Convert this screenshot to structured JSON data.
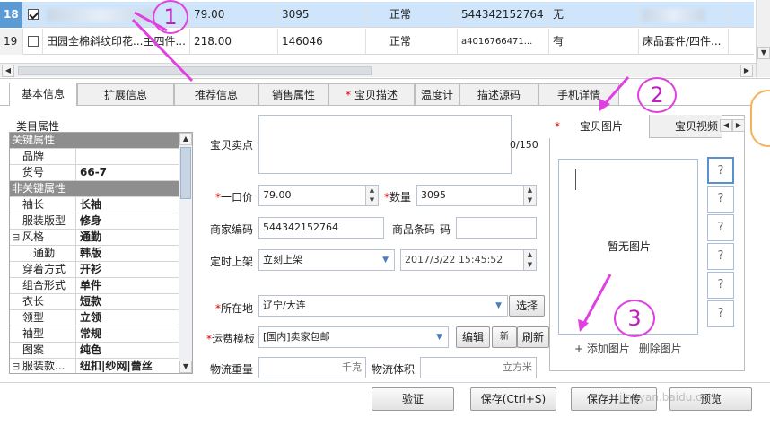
{
  "grid": {
    "rows": [
      {
        "num": "18",
        "checked": true,
        "title": "",
        "price": "79.00",
        "stock": "3095",
        "status": "正常",
        "code": "544342152764",
        "flag": "无",
        "category": ""
      },
      {
        "num": "19",
        "checked": false,
        "title": "田园全棉斜纹印花...主四件...",
        "price": "218.00",
        "stock": "146046",
        "status": "正常",
        "code": "a4016766471...",
        "flag": "有",
        "category": "床品套件/四件..."
      }
    ]
  },
  "tabs": [
    {
      "label": "基本信息",
      "required": false
    },
    {
      "label": "扩展信息",
      "required": false
    },
    {
      "label": "推荐信息",
      "required": false
    },
    {
      "label": "销售属性",
      "required": false
    },
    {
      "label": "宝贝描述",
      "required": true
    },
    {
      "label": "温度计",
      "required": false
    },
    {
      "label": "描述源码",
      "required": false
    },
    {
      "label": "手机详情",
      "required": false
    }
  ],
  "props": {
    "title": "类目属性",
    "rows": [
      {
        "k": "关键属性",
        "v": "",
        "header": true
      },
      {
        "k": "品牌",
        "v": ""
      },
      {
        "k": "货号",
        "v": "66-7"
      },
      {
        "k": "非关键属性",
        "v": "",
        "header": true
      },
      {
        "k": "袖长",
        "v": "长袖"
      },
      {
        "k": "服装版型",
        "v": "修身"
      },
      {
        "k": "风格",
        "v": "通勤",
        "expander": "−"
      },
      {
        "k": "通勤",
        "v": "韩版",
        "indent": true
      },
      {
        "k": "穿着方式",
        "v": "开衫"
      },
      {
        "k": "组合形式",
        "v": "单件"
      },
      {
        "k": "衣长",
        "v": "短款"
      },
      {
        "k": "领型",
        "v": "立领"
      },
      {
        "k": "袖型",
        "v": "常规"
      },
      {
        "k": "图案",
        "v": "纯色"
      },
      {
        "k": "服装款...",
        "v": "纽扣|纱网|蕾丝",
        "expander": "−"
      }
    ]
  },
  "form": {
    "selling_point_label": "宝贝卖点",
    "selling_point_count": "0/150",
    "price_label": "一口价",
    "price_value": "79.00",
    "qty_label": "数量",
    "qty_value": "3095",
    "merchant_code_label": "商家编码",
    "merchant_code_value": "544342152764",
    "barcode_label": "商品条码",
    "barcode_suffix": "码",
    "schedule_label": "定时上架",
    "schedule_value": "立刻上架",
    "schedule_time": "2017/3/22  15:45:52",
    "location_label": "所在地",
    "location_value": "辽宁/大连",
    "location_button": "选择",
    "shipping_label": "运费模板",
    "shipping_value": "[国内]卖家包邮",
    "edit_button": "编辑",
    "new_button": "新",
    "refresh_button": "刷新",
    "weight_label": "物流重量",
    "weight_unit": "千克",
    "volume_label": "物流体积",
    "volume_unit": "立方米"
  },
  "media": {
    "tab_images": "宝贝图片",
    "tab_video": "宝贝视频",
    "no_image": "暂无图片",
    "add_image": "添加图片",
    "delete_image": "删除图片",
    "thumbs": [
      "?",
      "?",
      "?",
      "?",
      "?",
      "?"
    ]
  },
  "footer": {
    "verify": "验证",
    "save": "保存(Ctrl+S)",
    "save_upload": "保存并上传",
    "preview": "预览"
  },
  "annotations": [
    "1",
    "2",
    "3"
  ],
  "watermark": "jingyan.baidu.com"
}
